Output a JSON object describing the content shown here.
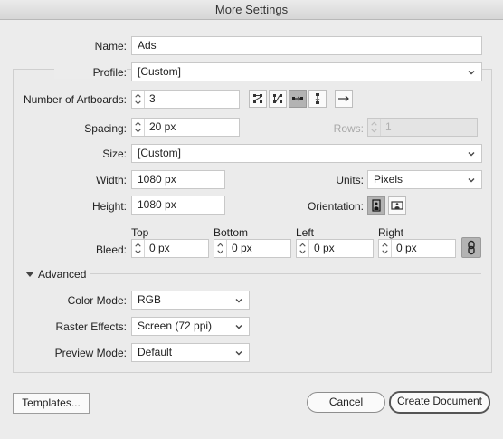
{
  "window": {
    "title": "More Settings"
  },
  "name": {
    "label": "Name:",
    "value": "Ads"
  },
  "profile": {
    "label": "Profile:",
    "value": "[Custom]"
  },
  "artboards": {
    "label": "Number of Artboards:",
    "value": "3",
    "layout_icons": [
      "grid-by-row-icon",
      "grid-by-column-icon",
      "arrange-by-row-icon",
      "arrange-by-column-icon"
    ],
    "selected_layout": "arrange-by-row-icon",
    "direction_icon": "arrow-right-icon"
  },
  "spacing": {
    "label": "Spacing:",
    "value": "20 px"
  },
  "rows": {
    "label": "Rows:",
    "value": "1"
  },
  "size": {
    "label": "Size:",
    "value": "[Custom]"
  },
  "width": {
    "label": "Width:",
    "value": "1080 px"
  },
  "units": {
    "label": "Units:",
    "value": "Pixels"
  },
  "height": {
    "label": "Height:",
    "value": "1080 px"
  },
  "orientation": {
    "label": "Orientation:",
    "selected": "portrait"
  },
  "bleed": {
    "label": "Bleed:",
    "top": {
      "label": "Top",
      "value": "0 px"
    },
    "bottom": {
      "label": "Bottom",
      "value": "0 px"
    },
    "left": {
      "label": "Left",
      "value": "0 px"
    },
    "right": {
      "label": "Right",
      "value": "0 px"
    },
    "link_icon": "chain-link-icon"
  },
  "advanced": {
    "label": "Advanced",
    "color_mode": {
      "label": "Color Mode:",
      "value": "RGB"
    },
    "raster_effects": {
      "label": "Raster Effects:",
      "value": "Screen (72 ppi)"
    },
    "preview_mode": {
      "label": "Preview Mode:",
      "value": "Default"
    }
  },
  "buttons": {
    "templates": "Templates...",
    "cancel": "Cancel",
    "create": "Create Document"
  }
}
